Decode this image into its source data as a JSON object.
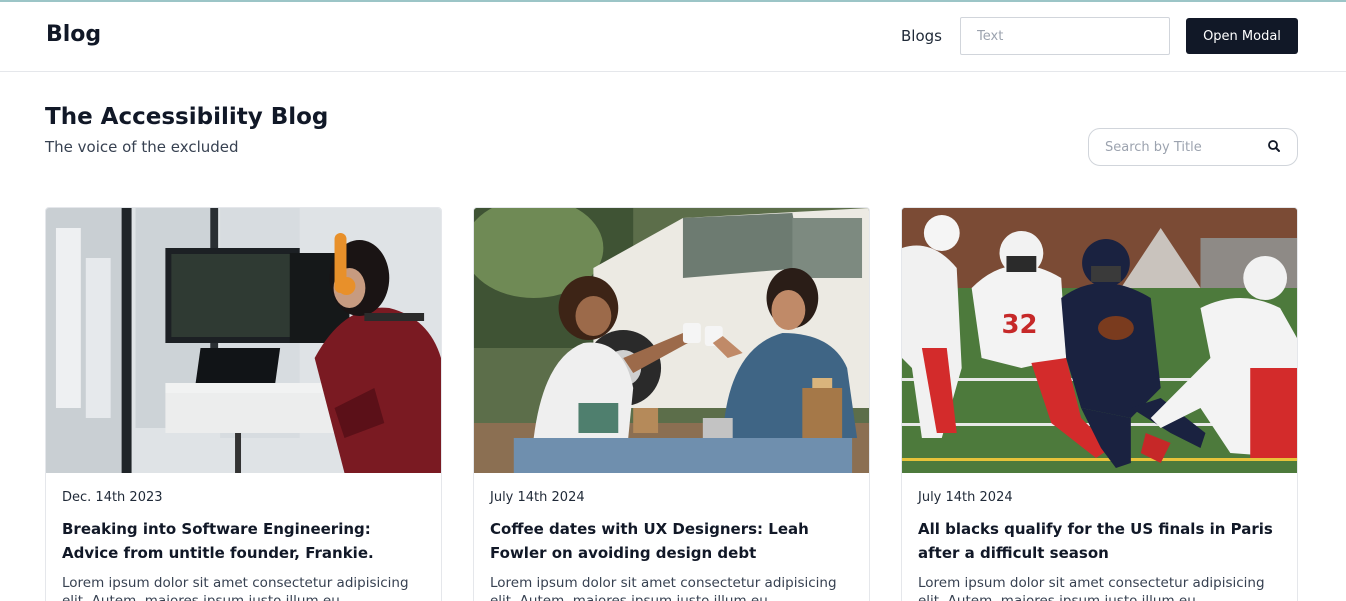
{
  "navbar": {
    "brand": "Blog",
    "link_label": "Blogs",
    "input_placeholder": "Text",
    "modal_button_label": "Open Modal"
  },
  "header": {
    "title": "The Accessibility Blog",
    "subtitle": "The voice of the excluded",
    "search_placeholder": "Search by Title",
    "search_icon": "search-icon"
  },
  "posts": [
    {
      "image": "person-coding-at-desk-with-headphones",
      "date": "Dec. 14th 2023",
      "title": "Breaking into Software Engineering: Advice from untitle founder, Frankie.",
      "excerpt": "Lorem ipsum dolor sit amet consectetur adipisicing elit. Autem, maiores ipsum iusto illum eu"
    },
    {
      "image": "two-people-toasting-coffee-by-truck",
      "date": "July 14th 2024",
      "title": "Coffee dates with UX Designers: Leah Fowler on avoiding design debt",
      "excerpt": "Lorem ipsum dolor sit amet consectetur adipisicing elit. Autem, maiores ipsum iusto illum eu"
    },
    {
      "image": "american-football-players-running",
      "date": "July 14th 2024",
      "title": "All blacks qualify for the US finals in Paris after a difficult season",
      "excerpt": "Lorem ipsum dolor sit amet consectetur adipisicing elit. Autem, maiores ipsum iusto illum eu"
    }
  ],
  "colors": {
    "primary_button": "#111827",
    "border": "#e5e7eb",
    "text": "#111827"
  }
}
